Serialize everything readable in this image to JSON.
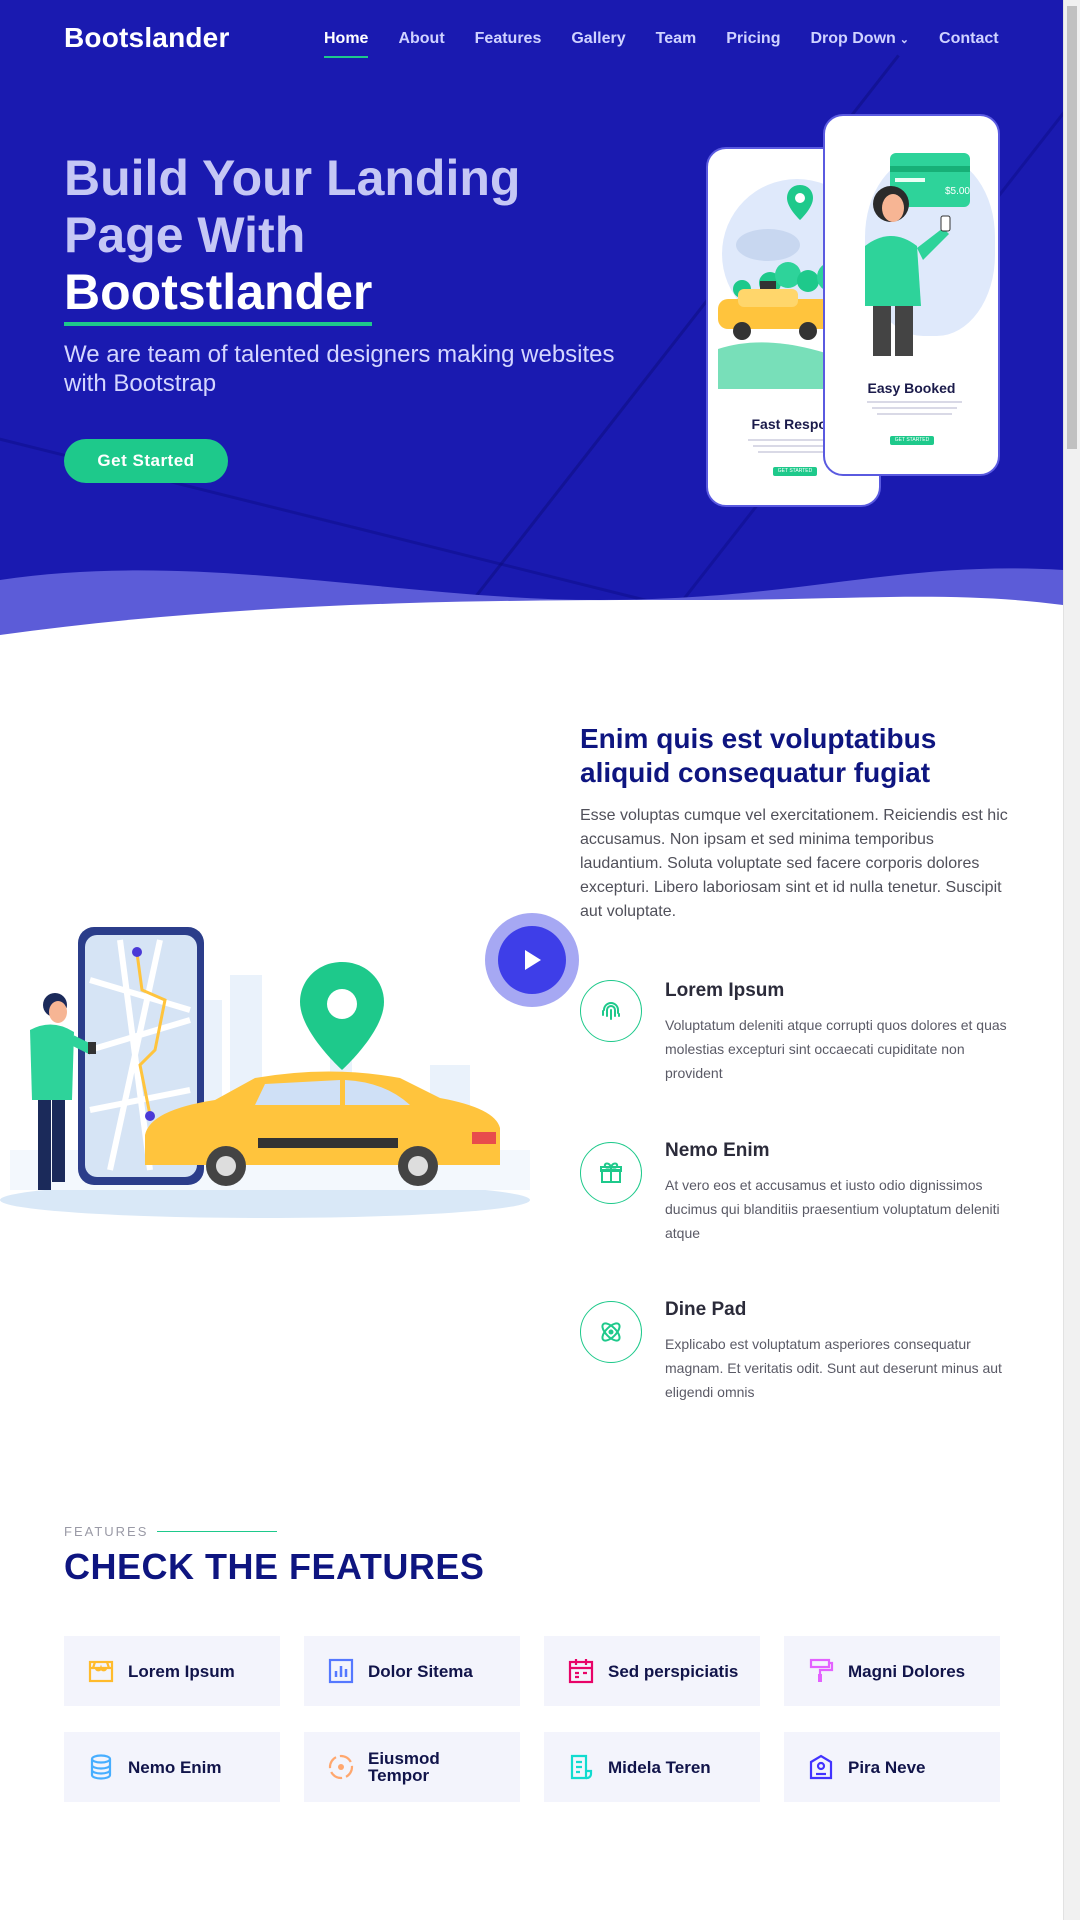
{
  "header": {
    "brand": "Bootslander",
    "nav": [
      {
        "label": "Home",
        "active": true
      },
      {
        "label": "About"
      },
      {
        "label": "Features"
      },
      {
        "label": "Gallery"
      },
      {
        "label": "Team"
      },
      {
        "label": "Pricing"
      },
      {
        "label": "Drop Down",
        "dropdown": true
      },
      {
        "label": "Contact"
      }
    ]
  },
  "hero": {
    "title_line1": "Build Your Landing",
    "title_line2": "Page With",
    "title_highlight": "Bootstlander",
    "subtitle": "We are team of talented designers making websites with Bootstrap",
    "cta_label": "Get Started",
    "phone1": {
      "title": "Fast Respon",
      "button": "GET STARTED"
    },
    "phone2": {
      "title": "Easy Booked",
      "button": "GET STARTED",
      "price": "$5.00"
    }
  },
  "about": {
    "title": "Enim quis est voluptatibus aliquid consequatur fugiat",
    "text": "Esse voluptas cumque vel exercitationem. Reiciendis est hic accusamus. Non ipsam et sed minima temporibus laudantium. Soluta voluptate sed facere corporis dolores excepturi. Libero laboriosam sint et id nulla tenetur. Suscipit aut voluptate.",
    "items": [
      {
        "icon": "fingerprint-icon",
        "title": "Lorem Ipsum",
        "text": "Voluptatum deleniti atque corrupti quos dolores et quas molestias excepturi sint occaecati cupiditate non provident"
      },
      {
        "icon": "gift-icon",
        "title": "Nemo Enim",
        "text": "At vero eos et accusamus et iusto odio dignissimos ducimus qui blanditiis praesentium voluptatum deleniti atque"
      },
      {
        "icon": "atom-icon",
        "title": "Dine Pad",
        "text": "Explicabo est voluptatum asperiores consequatur magnam. Et veritatis odit. Sunt aut deserunt minus aut eligendi omnis"
      }
    ]
  },
  "features": {
    "eyebrow": "FEATURES",
    "title": "CHECK THE FEATURES",
    "cards": [
      {
        "label": "Lorem Ipsum",
        "icon": "store-icon",
        "color": "#ffbb2c"
      },
      {
        "label": "Dolor Sitema",
        "icon": "bar-chart-icon",
        "color": "#5578ff"
      },
      {
        "label": "Sed perspiciatis",
        "icon": "calendar-icon",
        "color": "#e80368"
      },
      {
        "label": "Magni Dolores",
        "icon": "paint-roller-icon",
        "color": "#e361ff"
      },
      {
        "label": "Nemo Enim",
        "icon": "database-icon",
        "color": "#47aeff"
      },
      {
        "label": "Eiusmod Tempor",
        "icon": "gradienter-icon",
        "color": "#ffa76e"
      },
      {
        "label": "Midela Teren",
        "icon": "file-list-icon",
        "color": "#11dbcf"
      },
      {
        "label": "Pira Neve",
        "icon": "id-badge-icon",
        "color": "#4233ff"
      }
    ]
  }
}
